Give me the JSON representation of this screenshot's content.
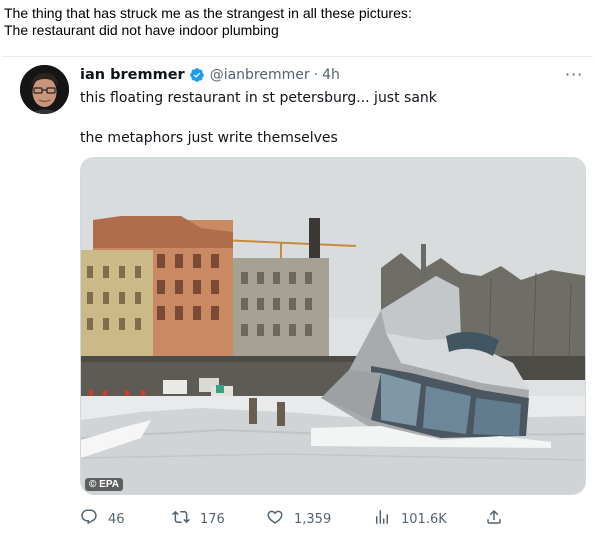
{
  "caption": {
    "line1": "The thing that has struck me as the strangest in all these pictures:",
    "line2": "The restaurant did not have indoor plumbing"
  },
  "tweet": {
    "author_name": "ian bremmer",
    "handle": "@ianbremmer",
    "separator": "·",
    "time": "4h",
    "more_label": "···",
    "text_line1": "this floating restaurant in st petersburg... just sank",
    "text_line2": "the metaphors just write themselves",
    "media_credit": "© EPA",
    "verified_color": "#1d9bf0"
  },
  "actions": {
    "replies": "46",
    "retweets": "176",
    "likes": "1,359",
    "views": "101.6K"
  },
  "icons": [
    "verified-badge-icon",
    "more-icon",
    "reply-icon",
    "retweet-icon",
    "like-icon",
    "views-icon",
    "share-icon"
  ]
}
